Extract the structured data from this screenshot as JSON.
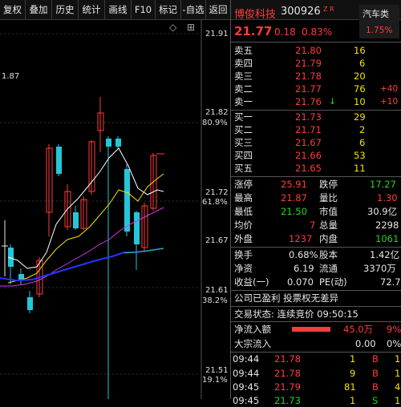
{
  "toolbar": {
    "items": [
      "复权",
      "叠加",
      "历史",
      "统计",
      "画线",
      "F10",
      "标记",
      "-自选",
      "返回"
    ]
  },
  "chart": {
    "price_ticks": [
      "21.91",
      "21.82",
      "21.72",
      "21.67",
      "21.61",
      "21.51"
    ],
    "pct_ticks": [
      "80.9%",
      "61.8%",
      "38.2%",
      "19.1%"
    ],
    "left_label": "1.87",
    "diamond_icon": "diamond-icon",
    "settings_icon": "settings-icon"
  },
  "stock": {
    "name": "博俊科技",
    "code": "300926",
    "tag": "Z R",
    "sector": "汽车类",
    "sector_change": "1.75%",
    "price": "21.77",
    "change": "0.18",
    "change_pct": "0.83%"
  },
  "order_book": {
    "asks": [
      {
        "label": "卖五",
        "price": "21.80",
        "vol": "16",
        "delta": ""
      },
      {
        "label": "卖四",
        "price": "21.79",
        "vol": "6",
        "delta": ""
      },
      {
        "label": "卖三",
        "price": "21.78",
        "vol": "20",
        "delta": ""
      },
      {
        "label": "卖二",
        "price": "21.77",
        "vol": "76",
        "delta": "+40"
      },
      {
        "label": "卖一",
        "price": "21.76",
        "vol": "10",
        "delta": "+10"
      }
    ],
    "bids": [
      {
        "label": "买一",
        "price": "21.73",
        "vol": "29"
      },
      {
        "label": "买二",
        "price": "21.71",
        "vol": "2"
      },
      {
        "label": "买三",
        "price": "21.67",
        "vol": "6"
      },
      {
        "label": "买四",
        "price": "21.66",
        "vol": "53"
      },
      {
        "label": "买五",
        "price": "21.65",
        "vol": "11"
      }
    ]
  },
  "stats": [
    {
      "l1": "涨停",
      "v1": "25.91",
      "l2": "跌停",
      "v2": "17.27"
    },
    {
      "l1": "最高",
      "v1": "21.87",
      "l2": "量比",
      "v2": "1.30"
    },
    {
      "l1": "最低",
      "v1": "21.50",
      "l2": "市值",
      "v2": "30.9亿"
    },
    {
      "l1": "均价",
      "v1": "7",
      "l2": "总量",
      "v2": "2298"
    },
    {
      "l1": "外盘",
      "v1": "1237",
      "l2": "内盘",
      "v2": "1061"
    }
  ],
  "stats2": [
    {
      "l1": "换手",
      "v1": "0.68%",
      "l2": "股本",
      "v2": "1.42亿"
    },
    {
      "l1": "净资",
      "v1": "6.19",
      "l2": "流通",
      "v2": "3370万"
    },
    {
      "l1": "收益(一)",
      "v1": "0.070",
      "l2": "PE(动)",
      "v2": "72.7"
    }
  ],
  "notice": "公司已盈利 投票权无差异",
  "trade_status": "交易状态: 连续竞价 09:50:15",
  "flows": [
    {
      "label": "净流入额",
      "value": "45.0万",
      "pct": "9%"
    },
    {
      "label": "大宗流入",
      "value": "0.00",
      "pct": "0%"
    }
  ],
  "ticks": [
    {
      "time": "09:44",
      "price": "21.78",
      "vol": "1",
      "side": "B",
      "flag": "1"
    },
    {
      "time": "09:44",
      "price": "21.78",
      "vol": "9",
      "side": "B",
      "flag": "1"
    },
    {
      "time": "09:45",
      "price": "21.79",
      "vol": "81",
      "side": "B",
      "flag": "4"
    },
    {
      "time": "09:45",
      "price": "21.73",
      "vol": "1",
      "side": "S",
      "flag": "1"
    }
  ]
}
